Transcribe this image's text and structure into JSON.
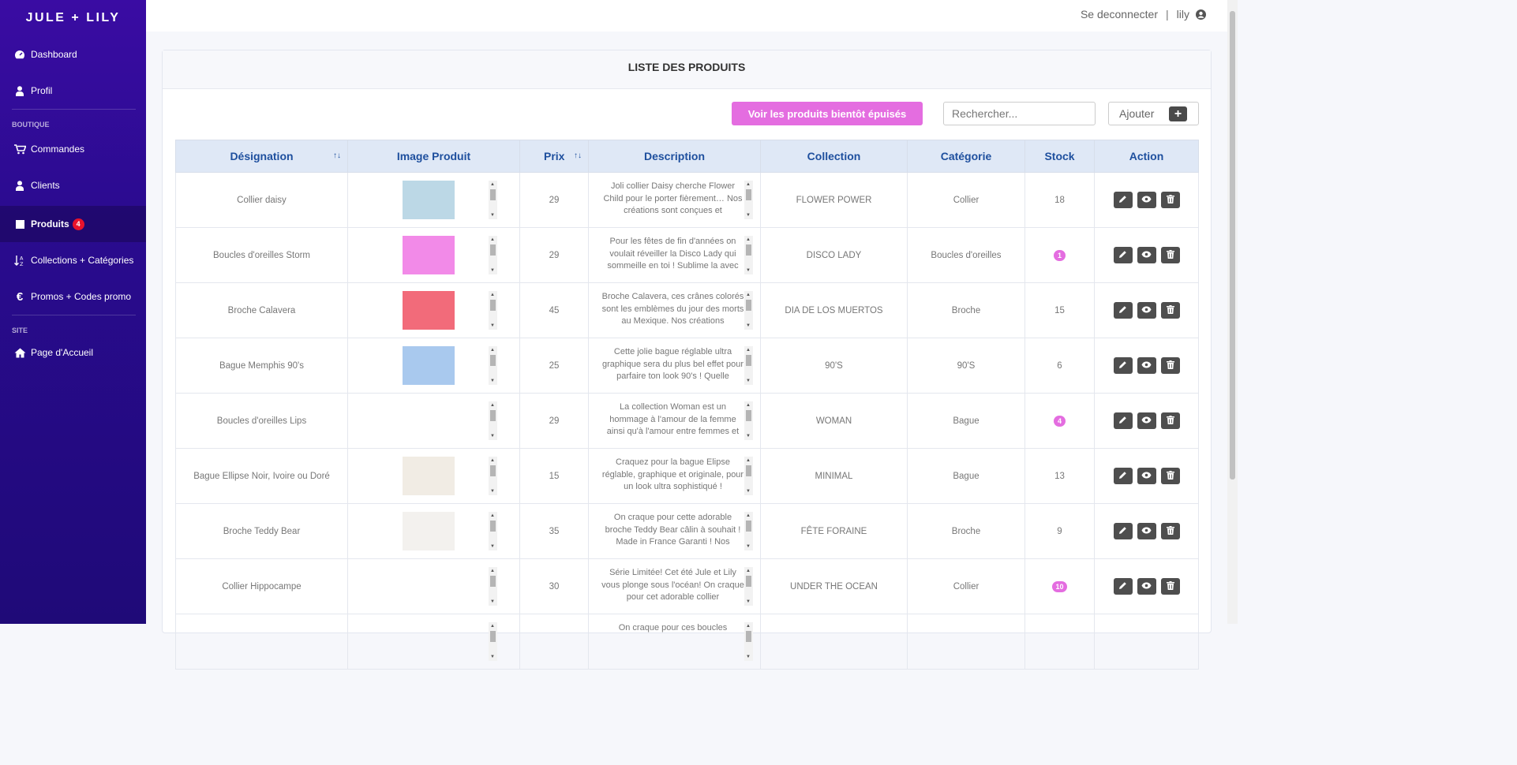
{
  "sidebar": {
    "brand": "JULE + LILY",
    "items": [
      {
        "label": "Dashboard",
        "icon": "gauge-icon"
      },
      {
        "label": "Profil",
        "icon": "user-icon"
      },
      {
        "label": "Commandes",
        "icon": "cart-icon"
      },
      {
        "label": "Clients",
        "icon": "user-icon"
      },
      {
        "label": "Produits",
        "icon": "square-icon",
        "badge": "4"
      },
      {
        "label": "Collections + Catégories",
        "icon": "sort-alpha-icon"
      },
      {
        "label": "Promos + Codes promo",
        "icon": "euro-icon"
      },
      {
        "label": "Page d'Accueil",
        "icon": "home-icon"
      }
    ],
    "sections": {
      "boutique": "BOUTIQUE",
      "site": "SITE"
    }
  },
  "topbar": {
    "logout": "Se deconnecter",
    "separator": "|",
    "user": "lily"
  },
  "card": {
    "title": "LISTE DES PRODUITS",
    "low_stock_button": "Voir les produits bientôt épuisés",
    "search_placeholder": "Rechercher...",
    "add_button": "Ajouter"
  },
  "table": {
    "headers": [
      "Désignation",
      "Image Produit",
      "Prix",
      "Description",
      "Collection",
      "Catégorie",
      "Stock",
      "Action"
    ],
    "rows": [
      {
        "name": "Collier daisy",
        "price": "29",
        "desc": "Joli collier Daisy cherche Flower Child pour le porter fièrement… Nos créations sont conçues et",
        "collection": "FLOWER POWER",
        "category": "Collier",
        "stock": "18",
        "low": false,
        "img_color": "#bcd8e6"
      },
      {
        "name": "Boucles d'oreilles Storm",
        "price": "29",
        "desc": "Pour les fêtes de fin d'années on voulait réveiller la Disco Lady qui sommeille en toi ! Sublime la avec",
        "collection": "DISCO LADY",
        "category": "Boucles d'oreilles",
        "stock": "1",
        "low": true,
        "img_color": "#f28ae8"
      },
      {
        "name": "Broche Calavera",
        "price": "45",
        "desc": "Broche Calavera, ces crânes colorés sont les emblèmes du jour des morts au Mexique. Nos créations",
        "collection": "DIA DE LOS MUERTOS",
        "category": "Broche",
        "stock": "15",
        "low": false,
        "img_color": "#f26b7a"
      },
      {
        "name": "Bague Memphis 90's",
        "price": "25",
        "desc": "Cette jolie bague réglable ultra graphique sera du plus bel effet pour parfaire ton look 90's ! Quelle",
        "collection": "90'S",
        "category": "90'S",
        "stock": "6",
        "low": false,
        "img_color": "#a9c9ee"
      },
      {
        "name": "Boucles d'oreilles Lips",
        "price": "29",
        "desc": "La collection Woman est un hommage à l'amour de la femme ainsi qu'à l'amour entre femmes et",
        "collection": "WOMAN",
        "category": "Bague",
        "stock": "4",
        "low": true,
        "img_color": "#ffffff"
      },
      {
        "name": "Bague Ellipse Noir, Ivoire ou Doré",
        "price": "15",
        "desc": "Craquez pour la bague Elipse réglable, graphique et originale, pour un look ultra sophistiqué !",
        "collection": "MINIMAL",
        "category": "Bague",
        "stock": "13",
        "low": false,
        "img_color": "#f1ece4"
      },
      {
        "name": "Broche Teddy Bear",
        "price": "35",
        "desc": "On craque pour cette adorable broche Teddy Bear câlin à souhait ! Made in France Garanti ! Nos",
        "collection": "FÊTE FORAINE",
        "category": "Broche",
        "stock": "9",
        "low": false,
        "img_color": "#f3f1ee"
      },
      {
        "name": "Collier Hippocampe",
        "price": "30",
        "desc": "Série Limitée! Cet été Jule et Lily vous plonge sous l'océan! On craque pour cet adorable collier",
        "collection": "UNDER THE OCEAN",
        "category": "Collier",
        "stock": "10",
        "low": true,
        "img_color": "#ffffff"
      },
      {
        "name": "",
        "price": "",
        "desc": "On craque pour ces boucles",
        "collection": "",
        "category": "",
        "stock": "",
        "low": false,
        "img_color": "#ffffff"
      }
    ]
  }
}
